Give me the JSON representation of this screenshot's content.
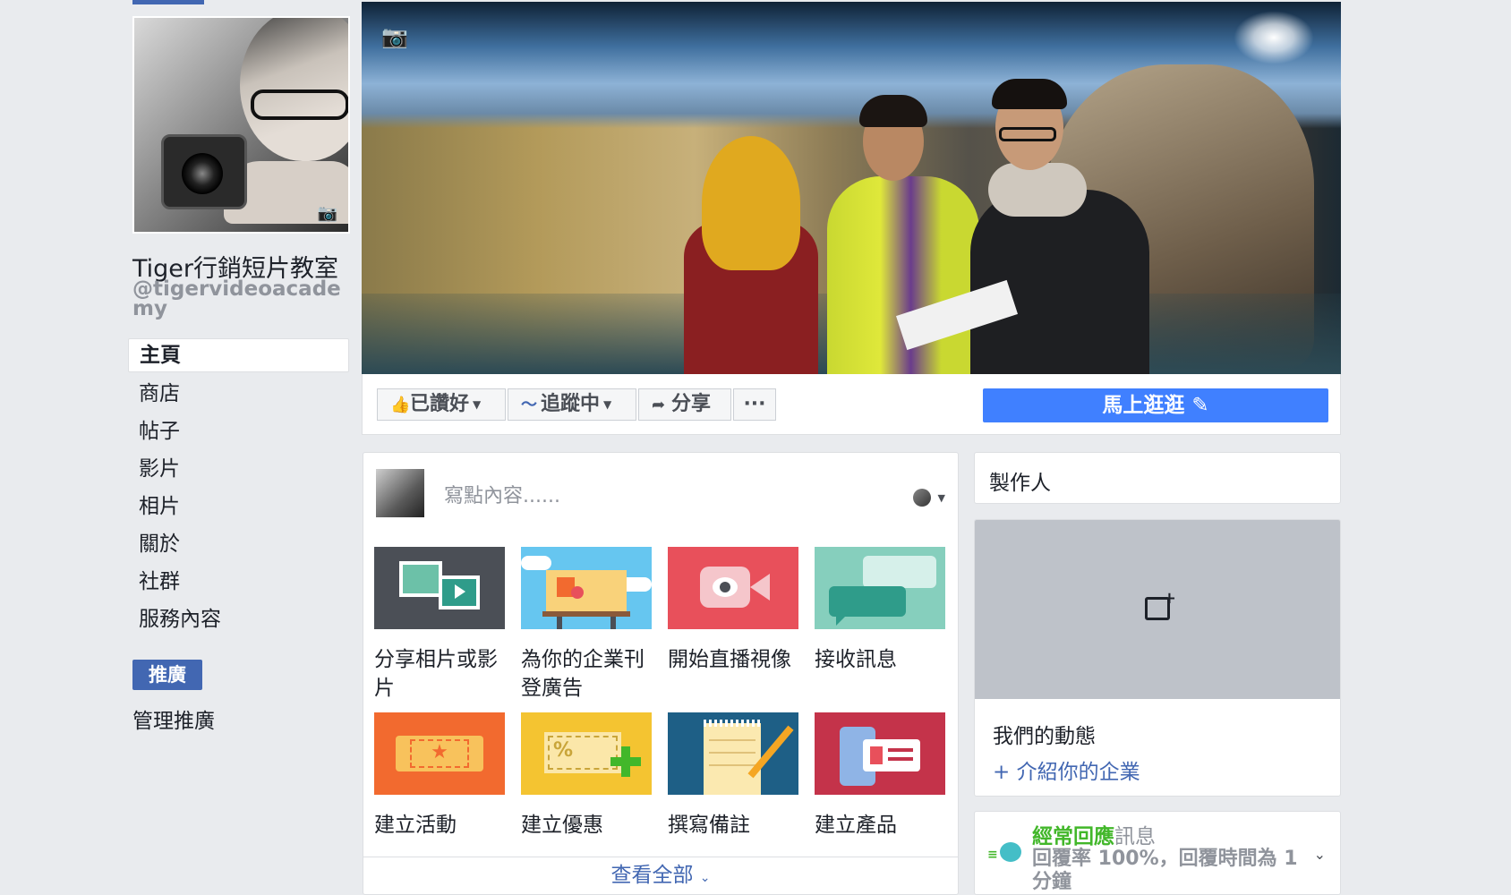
{
  "page": {
    "title": "Tiger行銷短片教室",
    "handle": "@tigervideoacademy"
  },
  "nav": {
    "items": [
      "主頁",
      "商店",
      "帖子",
      "影片",
      "相片",
      "關於",
      "社群",
      "服務內容"
    ],
    "promote_label": "推廣",
    "manage_promotions_label": "管理推廣"
  },
  "actions": {
    "like_label": "已讚好",
    "follow_label": "追蹤中",
    "share_label": "分享",
    "more_label": "···",
    "shop_label": "馬上逛逛"
  },
  "composer": {
    "placeholder": "寫點內容......",
    "tiles": [
      {
        "label": "分享相片或影片",
        "icon": "photo-video-icon"
      },
      {
        "label": "為你的企業刊登廣告",
        "icon": "billboard-icon"
      },
      {
        "label": "開始直播視像",
        "icon": "live-video-icon"
      },
      {
        "label": "接收訊息",
        "icon": "message-icon"
      },
      {
        "label": "建立活動",
        "icon": "ticket-icon"
      },
      {
        "label": "建立優惠",
        "icon": "coupon-icon"
      },
      {
        "label": "撰寫備註",
        "icon": "note-icon"
      },
      {
        "label": "建立產品",
        "icon": "product-icon"
      }
    ],
    "see_all_label": "查看全部"
  },
  "sidebar_right": {
    "creator_label": "製作人",
    "story_title": "我們的動態",
    "story_link": "+ 介紹你的企業",
    "response": {
      "title_green": "經常回應",
      "title_gray": "訊息",
      "detail": "回覆率 100%，回覆時間為 1 分鐘"
    }
  },
  "colors": {
    "brand": "#4267b2",
    "shop_button": "#4080ff",
    "response_green": "#42b72a",
    "background": "#e9ebee"
  }
}
